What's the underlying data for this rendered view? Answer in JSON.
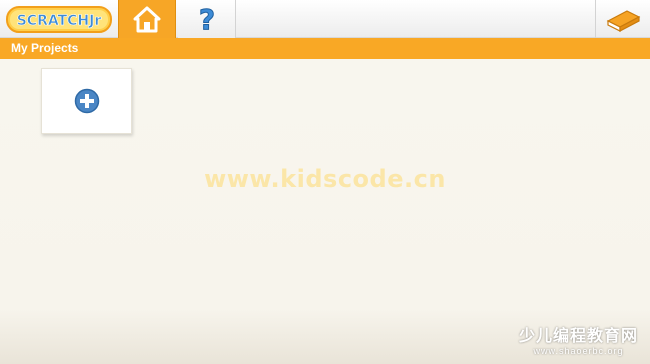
{
  "header": {
    "logo_text": "SCRATCHJr",
    "tabs": [
      {
        "id": "home",
        "icon": "home-icon",
        "active": true
      },
      {
        "id": "help",
        "icon": "question-mark-icon",
        "active": false
      }
    ],
    "book_icon": "book-icon"
  },
  "title_bar": {
    "label": "My Projects"
  },
  "projects": {
    "new_project_icon": "plus-circle-icon"
  },
  "watermarks": {
    "center": "www.kidscode.cn",
    "corner_title": "少儿编程教育网",
    "corner_url": "www.shaoerbc.org"
  },
  "colors": {
    "accent_orange": "#f9a825",
    "tab_active": "#f7a626",
    "logo_blue": "#3d8bd6",
    "plus_blue": "#4a86c5",
    "background": "#f7f4ec"
  }
}
